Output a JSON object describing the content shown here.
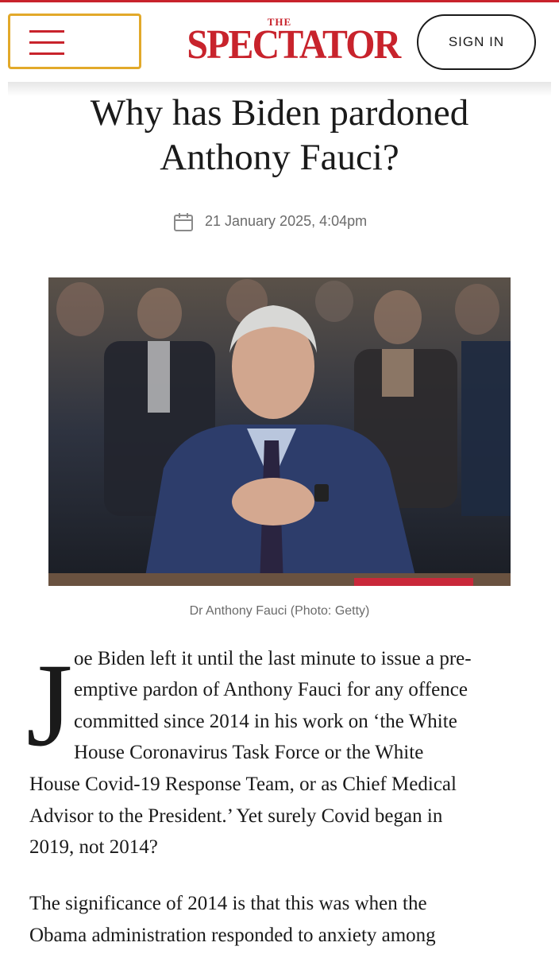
{
  "header": {
    "logo_the": "THE",
    "logo": "SPECTATOR",
    "menu_icon": "hamburger-menu-icon",
    "sign_in": "SIGN IN"
  },
  "colors": {
    "brand_red": "#c8232c",
    "menu_focus": "#e2a92a",
    "meta_gray": "#6b6b6b"
  },
  "article": {
    "title": "Why has Biden pardoned Anthony Fauci?",
    "date_icon": "calendar-icon",
    "date": "21 January 2025, 4:04pm",
    "image_caption": "Dr Anthony Fauci (Photo: Getty)",
    "drop_cap": "J",
    "para1_lines": [
      "oe Biden left it until the last minute to issue a pre-",
      "emptive pardon of Anthony Fauci for any offence",
      "committed since 2014 in his work on ‘the White",
      "House Coronavirus Task Force or the White",
      "House Covid-19 Response Team, or as Chief Medical",
      "Advisor to the President.’ Yet surely Covid began in",
      "2019, not 2014?"
    ],
    "para2_lines": [
      "The significance of 2014 is that this was when the",
      "Obama administration responded to anxiety among"
    ]
  }
}
